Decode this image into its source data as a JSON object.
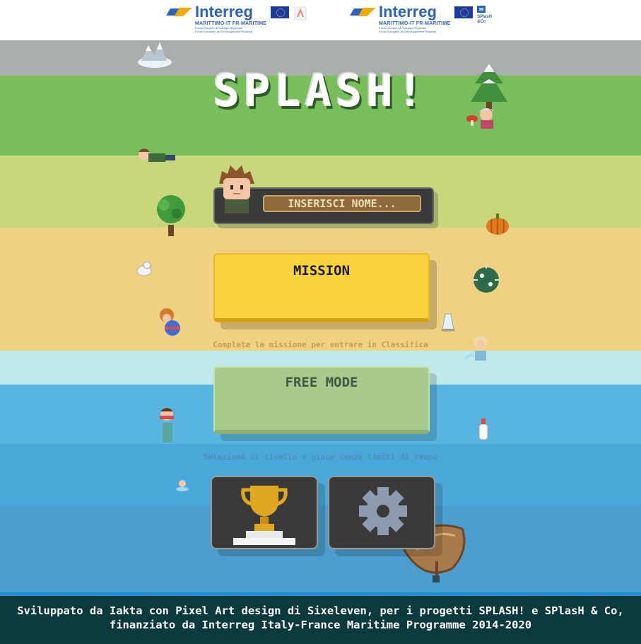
{
  "header": {
    "logo_left": {
      "brand": "Interreg",
      "program": "MARITTIMO-IT FR-MARITIME",
      "fund_line1": "Fondo Europeo di Sviluppo Regionale",
      "fund_line2": "Fonds Européen de Développement Régional"
    },
    "logo_right": {
      "brand": "Interreg",
      "program": "MARITTIMO-IT FR-MARITIME",
      "fund_line1": "Fondo Europeo di Sviluppo Regionale",
      "fund_line2": "Fonds Européen de Développement Régional",
      "project": "SPlasH &Co"
    }
  },
  "game": {
    "title": "SPLASH!",
    "name_placeholder": "INSERISCI NOME...",
    "mission_label": "MISSION",
    "mission_hint": "Completa la missione per entrare in Classifica",
    "free_mode_label": "FREE MODE",
    "free_mode_hint": "Seleziona il livello e gioca senza limiti di tempo"
  },
  "icons": {
    "leaderboard": "trophy-icon",
    "settings": "gear-icon"
  },
  "footer": {
    "line1": "Sviluppato da Iakta con Pixel Art design di Sixeleven, per i progetti SPLASH! e SPlasH & Co,",
    "line2": "finanziato da Interreg Italy-France Maritime Programme 2014-2020"
  },
  "colors": {
    "mission": "#f8d23c",
    "free_mode": "#a9c98d",
    "footer_bg": "#0b3a3e",
    "footer_border": "#1a8fd6"
  }
}
